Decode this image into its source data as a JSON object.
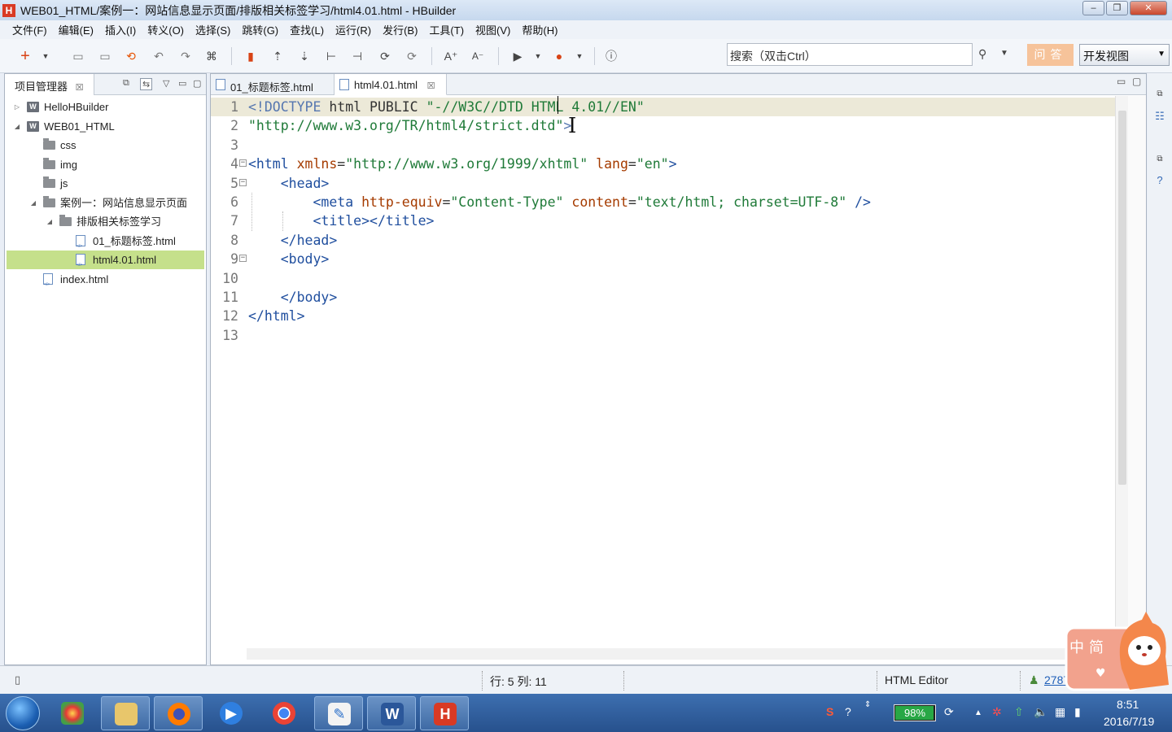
{
  "window": {
    "title": "WEB01_HTML/案例一：网站信息显示页面/排版相关标签学习/html4.01.html  - HBuilder",
    "app_icon": "H",
    "controls": {
      "minimize": "‒",
      "maximize": "❐",
      "close": "✕"
    }
  },
  "menu": [
    "文件(F)",
    "编辑(E)",
    "插入(I)",
    "转义(O)",
    "选择(S)",
    "跳转(G)",
    "查找(L)",
    "运行(R)",
    "发行(B)",
    "工具(T)",
    "视图(V)",
    "帮助(H)"
  ],
  "toolbar": {
    "search_placeholder": "搜索（双击Ctrl）",
    "qa_label": "问答",
    "view_select": "开发视图",
    "font_increase": "A⁺",
    "font_decrease": "A⁻"
  },
  "project_panel": {
    "tab_label": "项目管理器",
    "tree": [
      {
        "label": "HelloHBuilder",
        "type": "project",
        "depth": 0,
        "expanded": false,
        "twisty": "▷",
        "icon_text": "W"
      },
      {
        "label": "WEB01_HTML",
        "type": "project",
        "depth": 0,
        "expanded": true,
        "twisty": "◢",
        "icon_text": "W"
      },
      {
        "label": "css",
        "type": "folder",
        "depth": 1
      },
      {
        "label": "img",
        "type": "folder",
        "depth": 1
      },
      {
        "label": "js",
        "type": "folder",
        "depth": 1
      },
      {
        "label": "案例一：网站信息显示页面",
        "type": "folder",
        "depth": 1,
        "expanded": true,
        "twisty": "◢"
      },
      {
        "label": "排版相关标签学习",
        "type": "folder",
        "depth": 2,
        "expanded": true,
        "twisty": "◢"
      },
      {
        "label": "01_标题标签.html",
        "type": "file",
        "depth": 3
      },
      {
        "label": "html4.01.html",
        "type": "file",
        "depth": 3,
        "selected": true
      },
      {
        "label": "index.html",
        "type": "file",
        "depth": 1
      }
    ]
  },
  "editor": {
    "tabs": [
      {
        "label": "01_标题标签.html",
        "active": false
      },
      {
        "label": "html4.01.html",
        "active": true
      }
    ],
    "close_glyph": "☒",
    "current_line": 1,
    "lines": [
      {
        "n": "1",
        "fold": false,
        "parts": [
          [
            "doc",
            "<!DOCTYPE "
          ],
          [
            "plain",
            "html PUBLIC "
          ],
          [
            "str",
            "\"-//W3C//DTD HTML 4.01//EN\""
          ]
        ]
      },
      {
        "n": "2",
        "fold": false,
        "parts": [
          [
            "str",
            "\"http://www.w3.org/TR/html4/strict.dtd\""
          ],
          [
            "doc",
            ">"
          ]
        ]
      },
      {
        "n": "3",
        "fold": false,
        "parts": []
      },
      {
        "n": "4",
        "fold": true,
        "parts": [
          [
            "tag",
            "<html "
          ],
          [
            "attr",
            "xmlns"
          ],
          [
            "plain",
            "="
          ],
          [
            "str",
            "\"http://www.w3.org/1999/xhtml\""
          ],
          [
            "plain",
            " "
          ],
          [
            "attr",
            "lang"
          ],
          [
            "plain",
            "="
          ],
          [
            "str",
            "\"en\""
          ],
          [
            "tag",
            ">"
          ]
        ]
      },
      {
        "n": "5",
        "fold": true,
        "parts": [
          [
            "plain",
            "    "
          ],
          [
            "tag",
            "<head>"
          ]
        ]
      },
      {
        "n": "6",
        "fold": false,
        "parts": [
          [
            "plain",
            "        "
          ],
          [
            "tag",
            "<meta "
          ],
          [
            "attr",
            "http-equiv"
          ],
          [
            "plain",
            "="
          ],
          [
            "str",
            "\"Content-Type\""
          ],
          [
            "plain",
            " "
          ],
          [
            "attr",
            "content"
          ],
          [
            "plain",
            "="
          ],
          [
            "str",
            "\"text/html; charset=UTF-8\""
          ],
          [
            "plain",
            " "
          ],
          [
            "tag",
            "/>"
          ]
        ]
      },
      {
        "n": "7",
        "fold": false,
        "parts": [
          [
            "plain",
            "        "
          ],
          [
            "tag",
            "<title></title>"
          ]
        ]
      },
      {
        "n": "8",
        "fold": false,
        "parts": [
          [
            "plain",
            "    "
          ],
          [
            "tag",
            "</head>"
          ]
        ]
      },
      {
        "n": "9",
        "fold": true,
        "parts": [
          [
            "plain",
            "    "
          ],
          [
            "tag",
            "<body>"
          ]
        ]
      },
      {
        "n": "10",
        "fold": false,
        "parts": []
      },
      {
        "n": "11",
        "fold": false,
        "parts": [
          [
            "plain",
            "    "
          ],
          [
            "tag",
            "</body>"
          ]
        ]
      },
      {
        "n": "12",
        "fold": false,
        "parts": [
          [
            "tag",
            "</html>"
          ]
        ]
      },
      {
        "n": "13",
        "fold": false,
        "parts": []
      }
    ]
  },
  "statusbar": {
    "position": "行: 5 列: 11",
    "editor_type": "HTML Editor",
    "user_count": "2787"
  },
  "ime_widget": {
    "mode_cn": "中",
    "mode_simplified": "简"
  },
  "taskbar": {
    "battery": "98%",
    "battery_level": 0.98,
    "time": "8:51",
    "date": "2016/7/19"
  },
  "colors": {
    "selection": "#c5e08b",
    "current_line": "#ece9d8",
    "tag": "#1f4e9e",
    "attribute": "#a53b00",
    "string": "#1f7a38"
  }
}
